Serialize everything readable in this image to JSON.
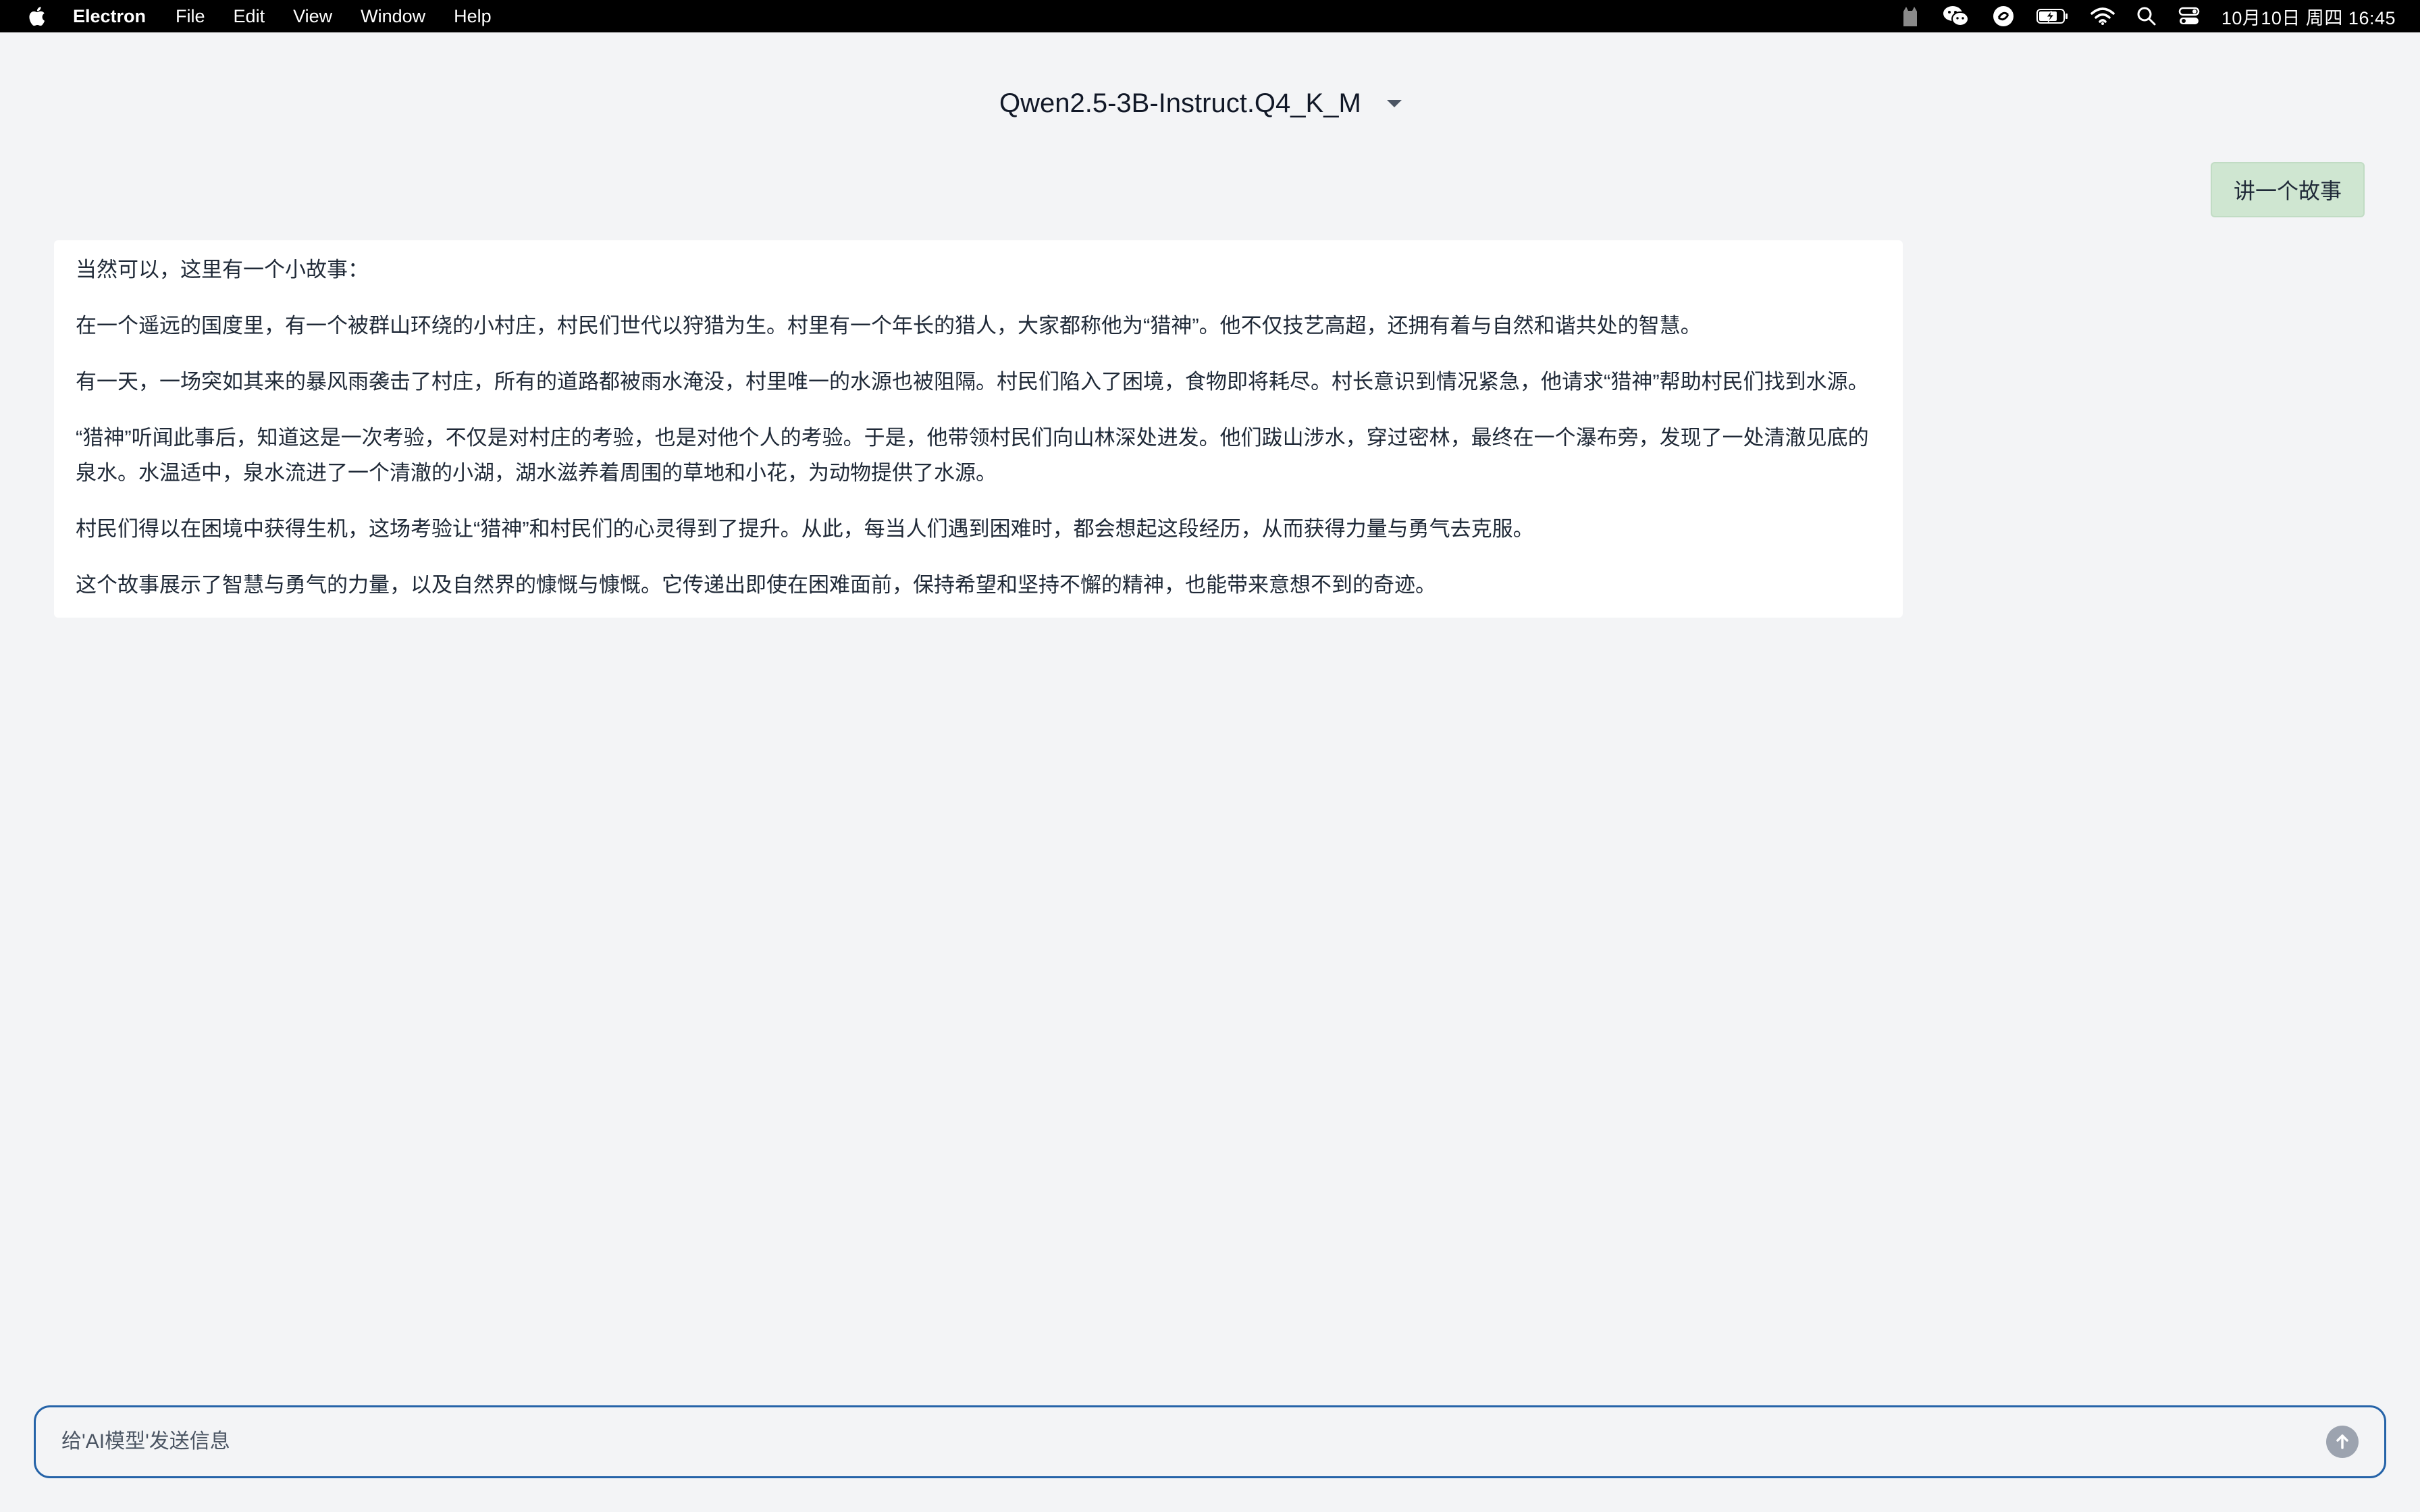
{
  "menubar": {
    "app_name": "Electron",
    "items": [
      "File",
      "Edit",
      "View",
      "Window",
      "Help"
    ],
    "clock": "10月10日 周四  16:45",
    "tray_icons": [
      "cat-icon",
      "wechat-icon",
      "sync-icon",
      "battery-icon",
      "wifi-icon",
      "search-icon",
      "control-center-icon"
    ]
  },
  "header": {
    "model_name": "Qwen2.5-3B-Instruct.Q4_K_M"
  },
  "chat": {
    "user_message": "讲一个故事",
    "assistant_paragraphs": [
      "当然可以，这里有一个小故事：",
      "在一个遥远的国度里，有一个被群山环绕的小村庄，村民们世代以狩猎为生。村里有一个年长的猎人，大家都称他为“猎神”。他不仅技艺高超，还拥有着与自然和谐共处的智慧。",
      "有一天，一场突如其来的暴风雨袭击了村庄，所有的道路都被雨水淹没，村里唯一的水源也被阻隔。村民们陷入了困境，食物即将耗尽。村长意识到情况紧急，他请求“猎神”帮助村民们找到水源。",
      "“猎神”听闻此事后，知道这是一次考验，不仅是对村庄的考验，也是对他个人的考验。于是，他带领村民们向山林深处进发。他们跋山涉水，穿过密林，最终在一个瀑布旁，发现了一处清澈见底的泉水。水温适中，泉水流进了一个清澈的小湖，湖水滋养着周围的草地和小花，为动物提供了水源。",
      "村民们得以在困境中获得生机，这场考验让“猎神”和村民们的心灵得到了提升。从此，每当人们遇到困难时，都会想起这段经历，从而获得力量与勇气去克服。",
      "这个故事展示了智慧与勇气的力量，以及自然界的慷慨与慷慨。它传递出即使在困难面前，保持希望和坚持不懈的精神，也能带来意想不到的奇迹。"
    ]
  },
  "composer": {
    "placeholder": "给'AI模型'发送信息",
    "value": ""
  }
}
